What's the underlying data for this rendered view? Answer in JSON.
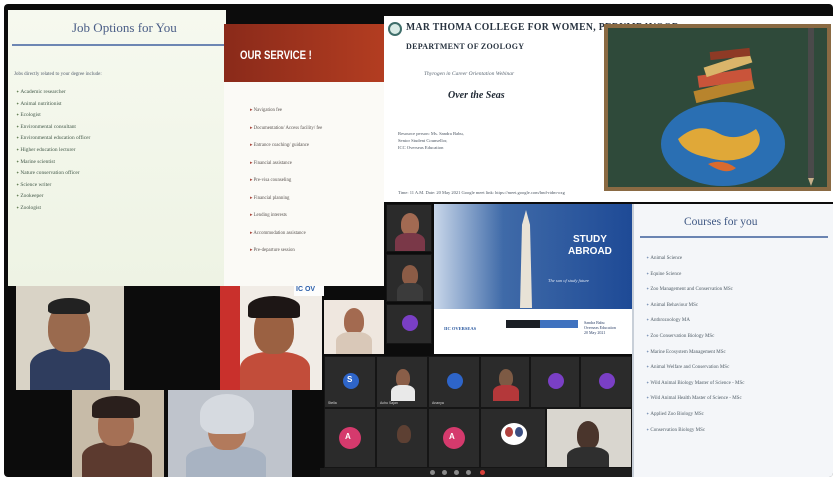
{
  "jobs": {
    "title": "Job Options for You",
    "intro": "Jobs directly related to your degree include:",
    "items": [
      "Academic researcher",
      "Animal nutritionist",
      "Ecologist",
      "Environmental consultant",
      "Environmental education officer",
      "Higher education lecturer",
      "Marine scientist",
      "Nature conservation officer",
      "Science writer",
      "Zookeeper",
      "Zoologist"
    ]
  },
  "service": {
    "title": "OUR SERVICE !",
    "items": [
      "Navigation fee",
      "Documentation/ Access facility/ fee",
      "Entrance coaching/ guidance",
      "Financial assistance",
      "Pre-visa counseling",
      "Financial planning",
      "Lending interests",
      "Accommodation assistance",
      "Pre-departure session"
    ]
  },
  "slide": {
    "college": "MAR THOMA COLLEGE FOR WOMEN, PERUMBAVOOR",
    "department": "DEPARTMENT OF ZOOLOGY",
    "subline": "Thyrogen in Career Orientation Webinar",
    "event": "Over the Seas",
    "resource_lines": [
      "Resource person: Ms. Sandra Babu,",
      "Senior Student Counsellor,",
      "ICC Overseas Education"
    ],
    "footer": "Time: 11 A.M.      Date: 20 May 2021      Google meet link: https://meet.google.com/hnd-rtdm-oxg"
  },
  "study": {
    "line1": "STUDY",
    "line2": "ABROAD",
    "tag": "The sun of study future",
    "logo": "IIC OVERSEAS",
    "small_lines": [
      "Sandra Babu",
      "Overseas Education",
      "20 May 2021"
    ]
  },
  "courses": {
    "title": "Courses for you",
    "items": [
      "Animal Science",
      "Equine Science",
      "Zoo Management and Conservation MSc",
      "Animal Behaviour MSc",
      "Anthrozoology MA",
      "Zoo Conservation Biology MSc",
      "Marine Ecosystem Management MSc",
      "Animal Welfare and Conservation MSc",
      "Wild Animal Biology Master of Science - MSc",
      "Wild Animal Health Master of Science - MSc",
      "Applied Zoo Biology MSc",
      "Conservation Biology MSc"
    ]
  },
  "meeting": {
    "tiles": [
      {
        "name": "Stella",
        "initial": "S"
      },
      {
        "name": "Achu Sajan",
        "initial": ""
      },
      {
        "name": "Ananya",
        "initial": "A"
      },
      {
        "name": "Ashima",
        "initial": "A"
      },
      {
        "name": "Ashmita",
        "initial": "A"
      },
      {
        "name": "Anjana",
        "initial": "A"
      },
      {
        "name": "Athira",
        "initial": "A"
      }
    ],
    "partial_logo": "IC OV"
  },
  "colors": {
    "frame": "#0c0c0c",
    "service_band": "#9c321d",
    "zoom_tile": "#2b2b2b",
    "avatar_blue": "#2e65c9",
    "avatar_pink": "#d53a6d",
    "avatar_purple": "#7a3fc5"
  }
}
